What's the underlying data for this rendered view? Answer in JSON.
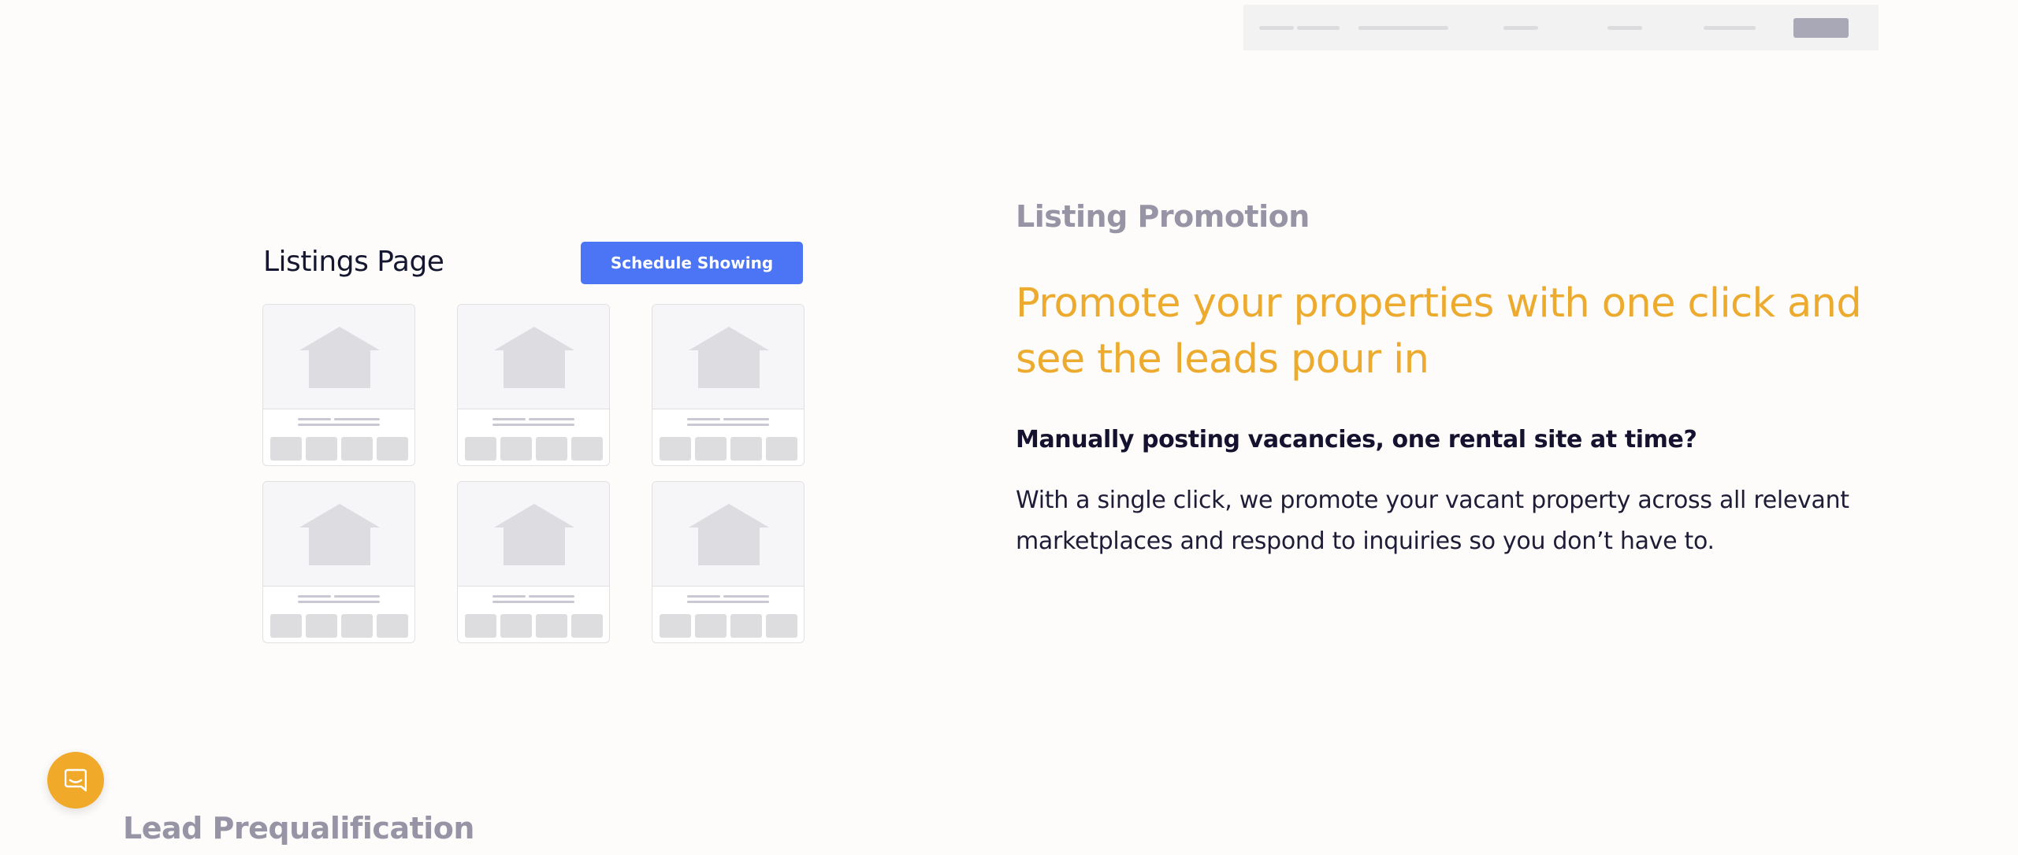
{
  "listings_panel": {
    "title": "Listings Page",
    "cta_label": "Schedule Showing",
    "card_count": 6
  },
  "feature": {
    "eyebrow": "Listing Promotion",
    "headline": "Promote your properties with one click and see the leads pour in",
    "subhead": "Manually posting vacancies, one rental site at time?",
    "body": "With a single click, we promote your vacant property across all relevant marketplaces and respond to inquiries so you don’t have to."
  },
  "next_section": {
    "eyebrow": "Lead Prequalification"
  },
  "chat": {
    "icon": "chat-icon"
  },
  "colors": {
    "accent_blue": "#4b75f4",
    "accent_orange": "#ecab2f",
    "muted_label": "#9794a6",
    "dark_text": "#14122f"
  }
}
